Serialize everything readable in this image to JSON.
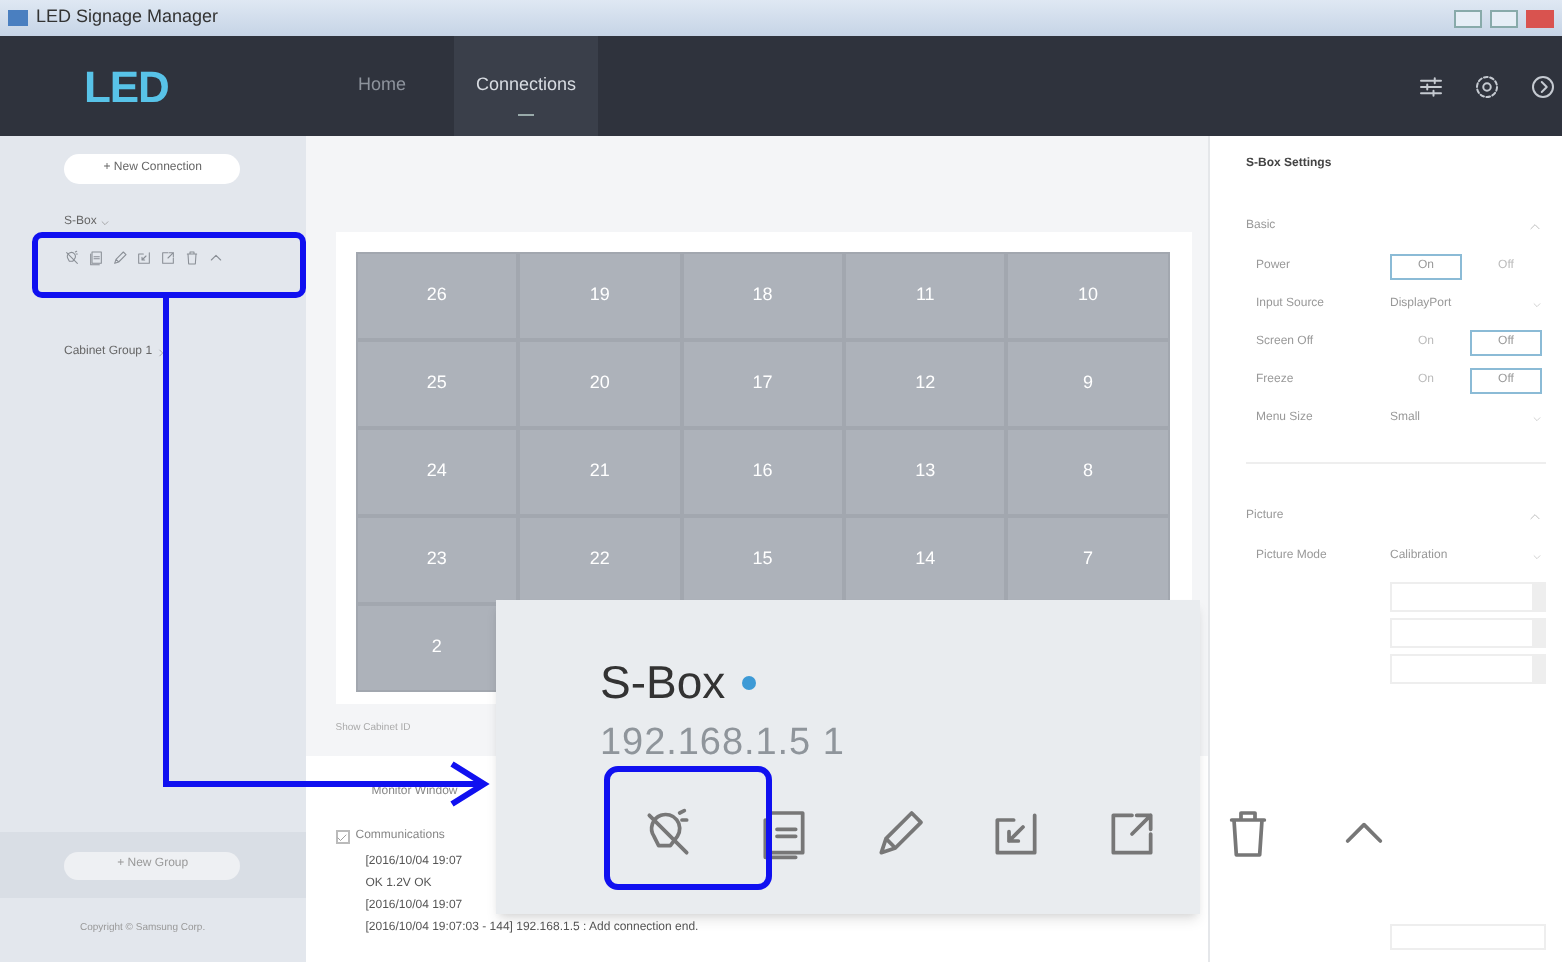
{
  "window": {
    "title": "LED Signage Manager"
  },
  "logo": "LED",
  "tabs": [
    {
      "label": "Home",
      "selected": false
    },
    {
      "label": "Connections",
      "selected": true
    }
  ],
  "sidebar": {
    "new_connection": "+ New Connection",
    "devices": [
      {
        "name": "S-Box",
        "expanded": true
      },
      {
        "name": "Cabinet Group 1",
        "expanded": false
      }
    ],
    "new_group": "+ New Group",
    "copyright": "Copyright © Samsung Corp."
  },
  "canvas": {
    "rows": [
      [
        "26",
        "19",
        "18",
        "11",
        "10"
      ],
      [
        "25",
        "20",
        "17",
        "12",
        "9"
      ],
      [
        "24",
        "21",
        "16",
        "13",
        "8"
      ],
      [
        "23",
        "22",
        "15",
        "14",
        "7"
      ],
      [
        "2"
      ]
    ]
  },
  "show_cabinet_id": "Show Cabinet ID",
  "monitor": {
    "title": "Monitor Window",
    "communications": {
      "label": "Communications",
      "checked": true
    },
    "log": [
      "[2016/10/04 19:07",
      "OK 1.2V OK",
      "[2016/10/04 19:07",
      "[2016/10/04 19:07:03 - 144] 192.168.1.5 : Add connection end."
    ]
  },
  "settings": {
    "title": "S-Box Settings",
    "sections": [
      {
        "title": "Basic",
        "expanded": true,
        "rows": [
          {
            "kind": "toggle",
            "label": "Power",
            "options": [
              {
                "label": "On",
                "selected": true
              },
              {
                "label": "Off",
                "selected": false
              }
            ]
          },
          {
            "kind": "select",
            "label": "Input Source",
            "value": "DisplayPort"
          },
          {
            "kind": "toggle",
            "label": "Screen Off",
            "options": [
              {
                "label": "On",
                "selected": false
              },
              {
                "label": "Off",
                "selected": true
              }
            ]
          },
          {
            "kind": "toggle",
            "label": "Freeze",
            "options": [
              {
                "label": "On",
                "selected": false
              },
              {
                "label": "Off",
                "selected": true
              }
            ]
          },
          {
            "kind": "select",
            "label": "Menu Size",
            "value": "Small"
          }
        ]
      },
      {
        "title": "Picture",
        "expanded": true,
        "rows": [
          {
            "kind": "select",
            "label": "Picture Mode",
            "value": "Calibration"
          }
        ]
      }
    ]
  },
  "inset": {
    "name": "S-Box",
    "online": true,
    "ip": "192.168.1.5 1"
  }
}
